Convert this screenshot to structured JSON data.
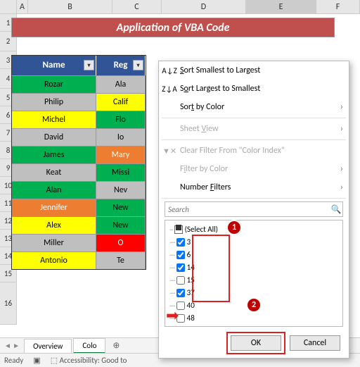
{
  "columns": [
    "A",
    "B",
    "C",
    "D",
    "E",
    "F"
  ],
  "rows": [
    "1",
    "2",
    "3",
    "4",
    "5",
    "6",
    "7",
    "8",
    "9",
    "10",
    "11",
    "12",
    "13",
    "14",
    "15",
    "16"
  ],
  "title": "Application of VBA Code",
  "table": {
    "headers": [
      "Name",
      "Reg"
    ],
    "rows": [
      {
        "name": "Rozar",
        "reg": "Ala",
        "nameClass": "green",
        "regClass": "grey"
      },
      {
        "name": "Philip",
        "reg": "Calif",
        "nameClass": "grey",
        "regClass": "yellow"
      },
      {
        "name": "Michel",
        "reg": "Flo",
        "nameClass": "yellow",
        "regClass": "green"
      },
      {
        "name": "David",
        "reg": "Io",
        "nameClass": "grey",
        "regClass": "grey"
      },
      {
        "name": "James",
        "reg": "Mary",
        "nameClass": "green",
        "regClass": "orange"
      },
      {
        "name": "Keat",
        "reg": "Missi",
        "nameClass": "grey",
        "regClass": "green"
      },
      {
        "name": "Alan",
        "reg": "Nev",
        "nameClass": "green",
        "regClass": "grey"
      },
      {
        "name": "Jennifer",
        "reg": "New",
        "nameClass": "orange",
        "regClass": "green"
      },
      {
        "name": "Alex",
        "reg": "New",
        "nameClass": "yellow",
        "regClass": "green"
      },
      {
        "name": "Miller",
        "reg": "O",
        "nameClass": "grey",
        "regClass": "red"
      },
      {
        "name": "Antonio",
        "reg": "Te",
        "nameClass": "yellow",
        "regClass": "grey"
      }
    ]
  },
  "menu": {
    "sortAsc": "Sort Smallest to Largest",
    "sortDesc": "Sort Largest to Smallest",
    "sortColor": "Sort by Color",
    "sheetView": "Sheet View",
    "clearFilter": "Clear Filter From \"Color Index\"",
    "filterColor": "Filter by Color",
    "numberFilters": "Number Filters",
    "searchPlaceholder": "Search",
    "selectAll": "(Select All)",
    "items": [
      {
        "label": "3",
        "checked": true
      },
      {
        "label": "6",
        "checked": true
      },
      {
        "label": "14",
        "checked": true
      },
      {
        "label": "15",
        "checked": false
      },
      {
        "label": "37",
        "checked": true
      },
      {
        "label": "40",
        "checked": false
      },
      {
        "label": "48",
        "checked": false
      }
    ],
    "ok": "OK",
    "cancel": "Cancel"
  },
  "sheets": {
    "nav": "◄ ►",
    "t1": "Overview",
    "t2": "Colo"
  },
  "status": {
    "ready": "Ready",
    "acc": "Accessibility: Good to"
  },
  "callouts": {
    "c1": "1",
    "c2": "2"
  }
}
